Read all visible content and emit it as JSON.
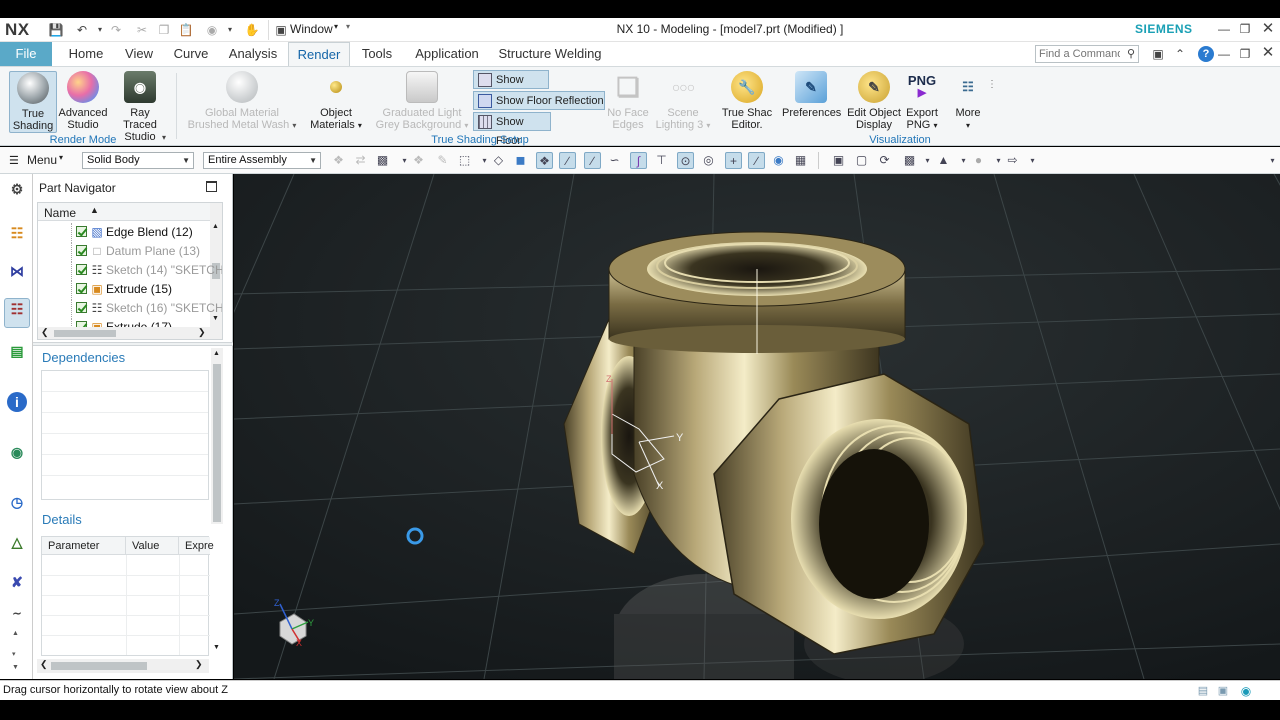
{
  "app": {
    "logo": "NX",
    "title": "NX 10 - Modeling - [model7.prt (Modified) ]",
    "brand": "SIEMENS",
    "window_menu": "Window"
  },
  "colors": {
    "file_tab": "#5aa9c8",
    "active_tab": "#1565a8",
    "group_label": "#2176b8",
    "brand": "#1aa0b5",
    "viewport_bg": "#1a1e1f"
  },
  "menu_tabs": [
    {
      "label": "File"
    },
    {
      "label": "Home"
    },
    {
      "label": "View"
    },
    {
      "label": "Curve"
    },
    {
      "label": "Analysis"
    },
    {
      "label": "Render"
    },
    {
      "label": "Tools"
    },
    {
      "label": "Application"
    },
    {
      "label": "Structure Welding"
    }
  ],
  "search": {
    "placeholder": "Find a Command"
  },
  "ribbon": {
    "render_mode": {
      "label": "Render Mode",
      "buttons": [
        {
          "label1": "True",
          "label2": "Shading"
        },
        {
          "label1": "Advanced",
          "label2": "Studio"
        },
        {
          "label1": "Ray Traced",
          "label2": "Studio"
        }
      ]
    },
    "global_material": {
      "label1": "Global Material",
      "label2": "Brushed Metal Wash"
    },
    "object_materials": {
      "label1": "Object",
      "label2": "Materials"
    },
    "graduated_light": {
      "label1": "Graduated Light",
      "label2": "Grey Background"
    },
    "true_shading_setup": {
      "label": "True Shading Setup",
      "items": [
        "Show Shac",
        "Show Floor Reflection",
        "Show Floor"
      ]
    },
    "no_face_edges": {
      "label1": "No Face",
      "label2": "Edges"
    },
    "scene_lighting": {
      "label1": "Scene",
      "label2": "Lighting 3"
    },
    "true_shac_editor": {
      "label1": "True Shac",
      "label2": "Editor."
    },
    "preferences": {
      "label1": "Preferences"
    },
    "edit_object_display": {
      "label1": "Edit Object",
      "label2": "Display"
    },
    "export_png": {
      "icon_text": "PNG",
      "label1": "Export",
      "label2": "PNG"
    },
    "more": {
      "label1": "More"
    },
    "visualization_label": "Visualization"
  },
  "toolbar2": {
    "menu_label": "Menu",
    "filter_value": "Solid Body",
    "assembly_value": "Entire Assembly"
  },
  "part_navigator": {
    "title": "Part Navigator",
    "column_name": "Name",
    "rows": [
      {
        "label": "Edge Blend (12)",
        "dim": false,
        "icon": "edge-blend-icon"
      },
      {
        "label": "Datum Plane (13)",
        "dim": true,
        "icon": "datum-plane-icon"
      },
      {
        "label": "Sketch (14) \"SKETCH",
        "dim": true,
        "icon": "sketch-icon"
      },
      {
        "label": "Extrude (15)",
        "dim": false,
        "icon": "extrude-icon"
      },
      {
        "label": "Sketch (16) \"SKETCH",
        "dim": true,
        "icon": "sketch-icon"
      },
      {
        "label": "Extrude (17)",
        "dim": false,
        "icon": "extrude-icon"
      }
    ],
    "dependencies_title": "Dependencies",
    "details_title": "Details",
    "details_columns": [
      "Parameter",
      "Value",
      "Expre"
    ]
  },
  "viewport": {
    "csys_labels": {
      "x": "X",
      "y": "Y",
      "z": "Z"
    },
    "triad_labels": {
      "x": "X",
      "y": "Y",
      "z": "Z"
    }
  },
  "status": {
    "message": "Drag cursor horizontally to rotate view about Z"
  }
}
